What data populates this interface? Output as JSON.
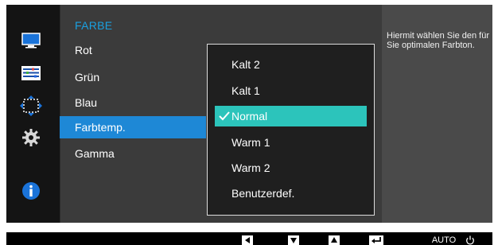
{
  "menu": {
    "header": "FARBE",
    "items": [
      {
        "label": "Rot",
        "active": false
      },
      {
        "label": "Grün",
        "active": false
      },
      {
        "label": "Blau",
        "active": false
      },
      {
        "label": "Farbtemp.",
        "active": true
      },
      {
        "label": "Gamma",
        "active": false
      }
    ]
  },
  "submenu": {
    "items": [
      {
        "label": "Kalt 2",
        "selected": false
      },
      {
        "label": "Kalt 1",
        "selected": false
      },
      {
        "label": "Normal",
        "selected": true
      },
      {
        "label": "Warm 1",
        "selected": false
      },
      {
        "label": "Warm 2",
        "selected": false
      },
      {
        "label": "Benutzerdef.",
        "selected": false
      }
    ]
  },
  "help": {
    "text": "Hiermit wählen Sie den für Sie optimalen Farbton."
  },
  "rail": {
    "icons": [
      "picture-icon",
      "color-icon",
      "size-position-icon",
      "setup-icon",
      "information-icon"
    ]
  },
  "bottom_bar": {
    "buttons": [
      "left-arrow-icon",
      "down-arrow-icon",
      "up-arrow-icon",
      "enter-icon"
    ],
    "auto_label": "AUTO",
    "power_icon": "power-icon"
  },
  "colors": {
    "highlight_blue": "#1e88d6",
    "header_blue": "#1aa0e0",
    "selected_teal": "#2cc4bb",
    "panel_dark": "#3b3b3b",
    "rail_dark": "#141414"
  }
}
